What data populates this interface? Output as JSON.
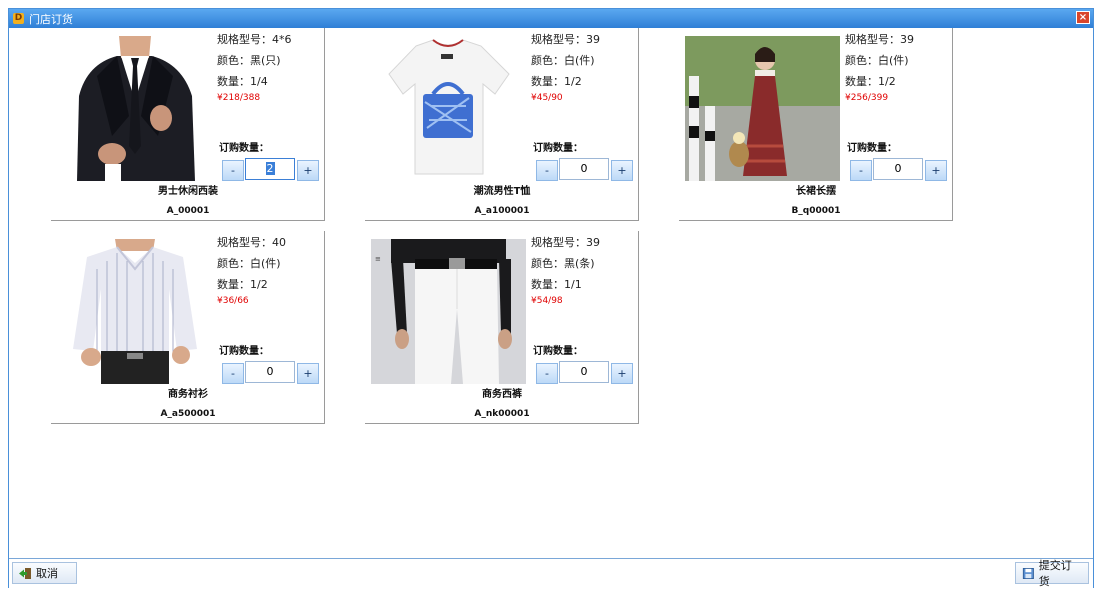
{
  "window": {
    "title": "门店订货",
    "icon": "app-logo-icon",
    "close_icon": "close-icon",
    "close_label": "×"
  },
  "labels": {
    "spec_prefix": "规格型号：",
    "color_prefix": "颜色：",
    "qty_prefix": "数量：",
    "order_qty": "订购数量：",
    "minus": "-",
    "plus": "+"
  },
  "products": [
    {
      "spec": "规格型号：4*6",
      "color": "颜色：黑(只)",
      "qty": "数量：1/4",
      "price": "¥218/388",
      "order_qty": "2",
      "name": "男士休闲西装",
      "code": "A_00001",
      "image": "suit-photo"
    },
    {
      "spec": "规格型号：39",
      "color": "颜色：白(件)",
      "qty": "数量：1/2",
      "price": "¥45/90",
      "order_qty": "0",
      "name": "潮流男性T恤",
      "code": "A_a100001",
      "image": "tshirt-photo"
    },
    {
      "spec": "规格型号：39",
      "color": "颜色：白(件)",
      "qty": "数量：1/2",
      "price": "¥256/399",
      "order_qty": "0",
      "name": "长裙长摆",
      "code": "B_q00001",
      "image": "dress-photo"
    },
    {
      "spec": "规格型号：40",
      "color": "颜色：白(件)",
      "qty": "数量：1/2",
      "price": "¥36/66",
      "order_qty": "0",
      "name": "商务衬衫",
      "code": "A_a500001",
      "image": "shirt-photo"
    },
    {
      "spec": "规格型号：39",
      "color": "颜色：黑(条)",
      "qty": "数量：1/1",
      "price": "¥54/98",
      "order_qty": "0",
      "name": "商务西裤",
      "code": "A_nk00001",
      "image": "trousers-photo"
    }
  ],
  "footer": {
    "cancel_label": "取消",
    "cancel_icon": "exit-door-icon",
    "submit_label": "提交订货",
    "submit_icon": "save-disk-icon"
  },
  "colors": {
    "title_bar": "#2f7fd6",
    "price": "#e00000",
    "button_border": "#8fb8e6"
  }
}
